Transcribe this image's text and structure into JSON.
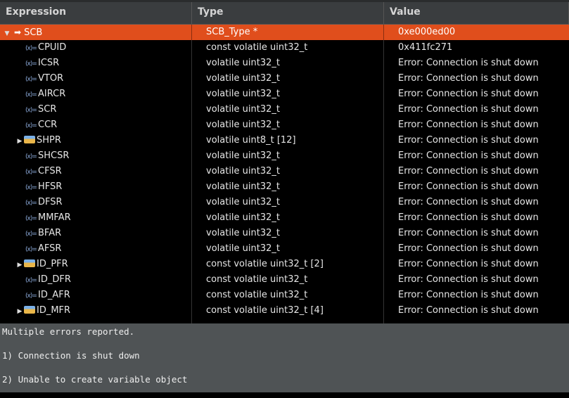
{
  "columns": [
    "Expression",
    "Type",
    "Value"
  ],
  "rows": [
    {
      "name": "SCB",
      "type": "SCB_Type *",
      "value": "0xe000ed00",
      "kind": "pointer",
      "expanded": true,
      "level": 0,
      "selected": true
    },
    {
      "name": "CPUID",
      "type": "const volatile uint32_t",
      "value": "0x411fc271",
      "kind": "var",
      "level": 1
    },
    {
      "name": "ICSR",
      "type": "volatile uint32_t",
      "value": "Error: Connection is shut down",
      "kind": "var",
      "level": 1
    },
    {
      "name": "VTOR",
      "type": "volatile uint32_t",
      "value": "Error: Connection is shut down",
      "kind": "var",
      "level": 1
    },
    {
      "name": "AIRCR",
      "type": "volatile uint32_t",
      "value": "Error: Connection is shut down",
      "kind": "var",
      "level": 1
    },
    {
      "name": "SCR",
      "type": "volatile uint32_t",
      "value": "Error: Connection is shut down",
      "kind": "var",
      "level": 1
    },
    {
      "name": "CCR",
      "type": "volatile uint32_t",
      "value": "Error: Connection is shut down",
      "kind": "var",
      "level": 1
    },
    {
      "name": "SHPR",
      "type": "volatile uint8_t [12]",
      "value": "Error: Connection is shut down",
      "kind": "array",
      "level": 1
    },
    {
      "name": "SHCSR",
      "type": "volatile uint32_t",
      "value": "Error: Connection is shut down",
      "kind": "var",
      "level": 1
    },
    {
      "name": "CFSR",
      "type": "volatile uint32_t",
      "value": "Error: Connection is shut down",
      "kind": "var",
      "level": 1
    },
    {
      "name": "HFSR",
      "type": "volatile uint32_t",
      "value": "Error: Connection is shut down",
      "kind": "var",
      "level": 1
    },
    {
      "name": "DFSR",
      "type": "volatile uint32_t",
      "value": "Error: Connection is shut down",
      "kind": "var",
      "level": 1
    },
    {
      "name": "MMFAR",
      "type": "volatile uint32_t",
      "value": "Error: Connection is shut down",
      "kind": "var",
      "level": 1
    },
    {
      "name": "BFAR",
      "type": "volatile uint32_t",
      "value": "Error: Connection is shut down",
      "kind": "var",
      "level": 1
    },
    {
      "name": "AFSR",
      "type": "volatile uint32_t",
      "value": "Error: Connection is shut down",
      "kind": "var",
      "level": 1
    },
    {
      "name": "ID_PFR",
      "type": "const volatile uint32_t [2]",
      "value": "Error: Connection is shut down",
      "kind": "array",
      "level": 1
    },
    {
      "name": "ID_DFR",
      "type": "const volatile uint32_t",
      "value": "Error: Connection is shut down",
      "kind": "var",
      "level": 1
    },
    {
      "name": "ID_AFR",
      "type": "const volatile uint32_t",
      "value": "Error: Connection is shut down",
      "kind": "var",
      "level": 1
    },
    {
      "name": "ID_MFR",
      "type": "const volatile uint32_t [4]",
      "value": "Error: Connection is shut down",
      "kind": "array",
      "level": 1
    }
  ],
  "message": {
    "lines": [
      "Multiple errors reported.",
      "1) Connection is shut down",
      "2) Unable to create variable object"
    ]
  },
  "colors": {
    "selection": "#e04e1c",
    "header": "#3a3d3f",
    "message_bg": "#4f5355"
  }
}
